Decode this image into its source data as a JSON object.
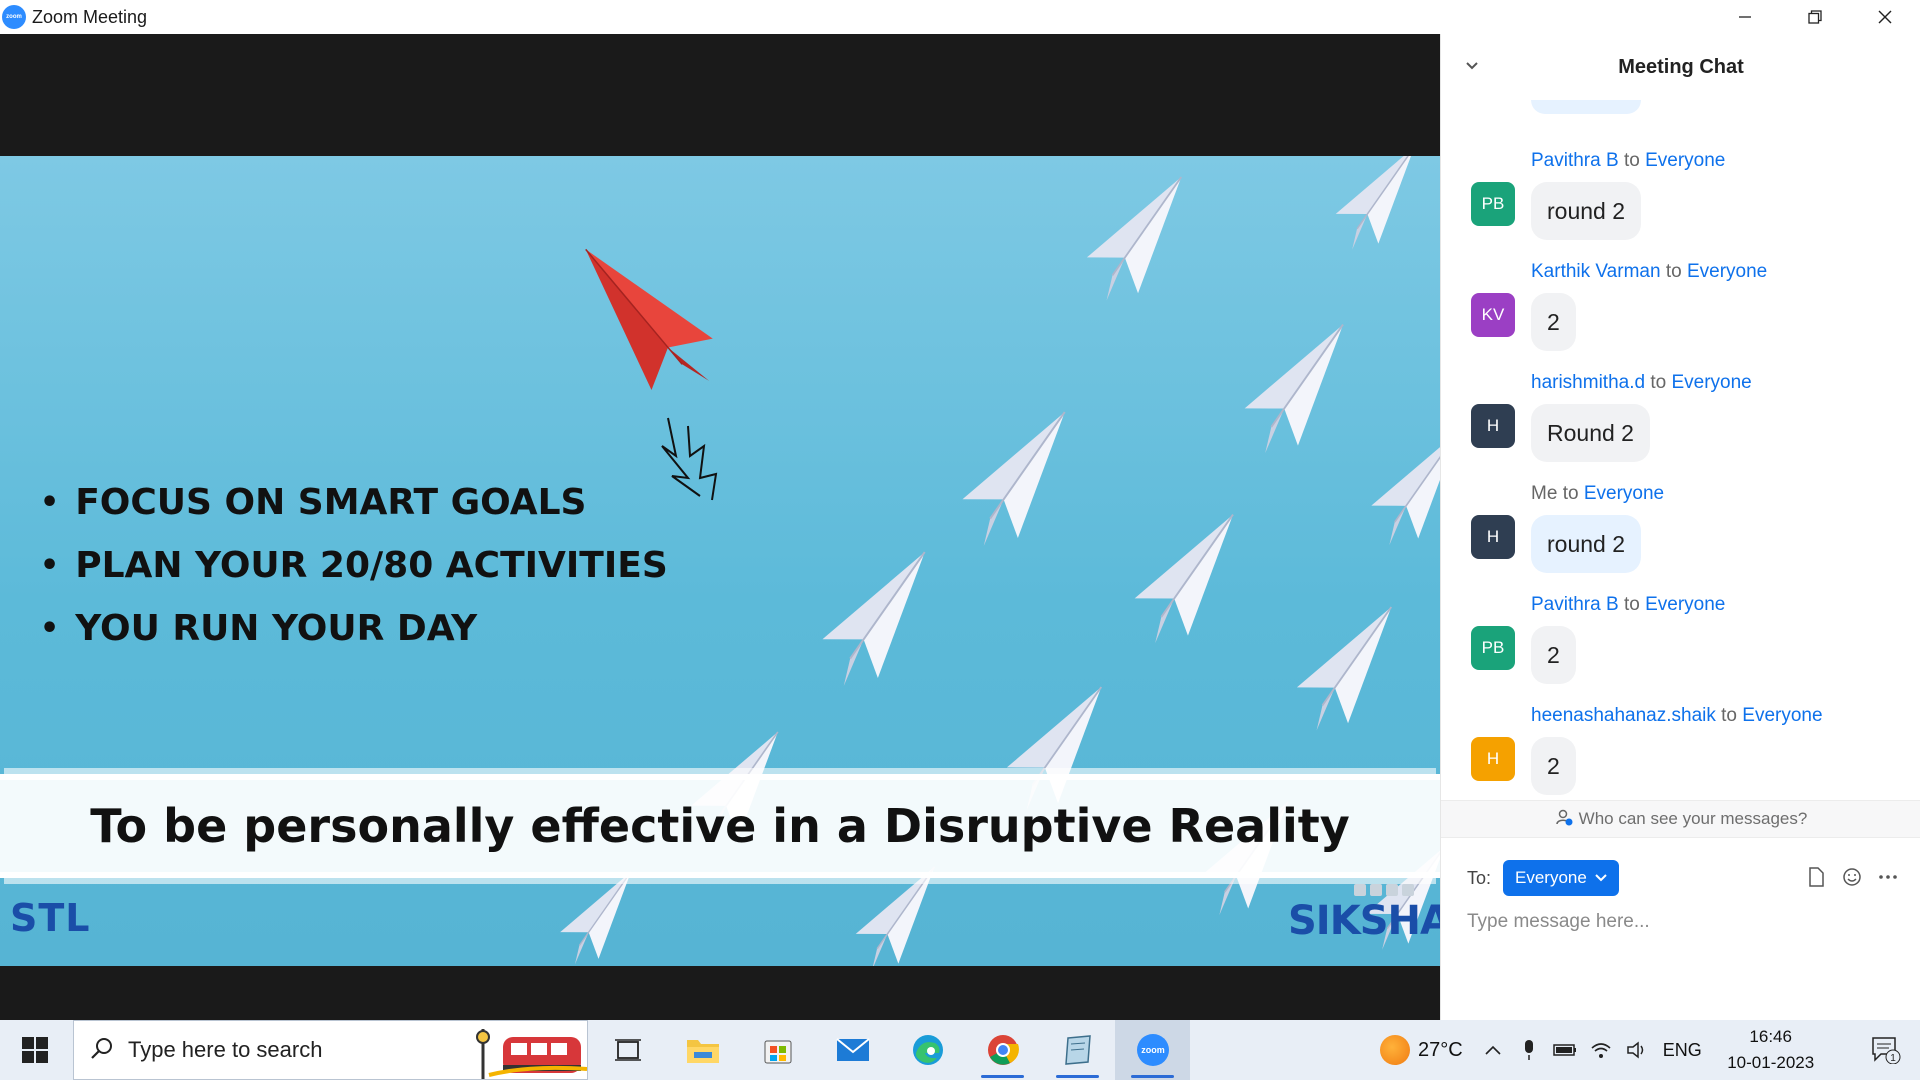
{
  "window": {
    "title": "Zoom Meeting",
    "logo_text": "zoom"
  },
  "slide": {
    "bullets": [
      "FOCUS ON SMART GOALS",
      "PLAN YOUR 20/80 ACTIVITIES",
      "YOU RUN YOUR DAY"
    ],
    "banner": "To be personally effective in a Disruptive Reality",
    "left_logo": "STL",
    "right_logo": "SIKSHA",
    "right_logo_tm": "™"
  },
  "chat": {
    "title": "Meeting Chat",
    "messages": [
      {
        "sender": "Pavithra B",
        "to_word": "to",
        "target": "Everyone",
        "initials": "PB",
        "avatar_color": "#1aa37a",
        "text": "round 2",
        "is_me": false
      },
      {
        "sender": "Karthik Varman",
        "to_word": "to",
        "target": "Everyone",
        "initials": "KV",
        "avatar_color": "#9b3fc4",
        "text": "2",
        "is_me": false
      },
      {
        "sender": "harishmitha.d",
        "to_word": "to",
        "target": "Everyone",
        "initials": "H",
        "avatar_color": "#2f3e52",
        "text": "Round 2",
        "is_me": false
      },
      {
        "sender": "Me",
        "to_word": "to",
        "target": "Everyone",
        "initials": "H",
        "avatar_color": "#2f3e52",
        "text": "round 2",
        "is_me": true
      },
      {
        "sender": "Pavithra B",
        "to_word": "to",
        "target": "Everyone",
        "initials": "PB",
        "avatar_color": "#1aa37a",
        "text": "2",
        "is_me": false
      },
      {
        "sender": "heenashahanaz.shaik",
        "to_word": "to",
        "target": "Everyone",
        "initials": "H",
        "avatar_color": "#f5a100",
        "text": "2",
        "is_me": false
      }
    ],
    "privacy_text": "Who can see your messages?",
    "to_label": "To:",
    "to_selected": "Everyone",
    "input_placeholder": "Type message here..."
  },
  "taskbar": {
    "search_placeholder": "Type here to search",
    "apps": [
      "task-view",
      "file-explorer",
      "microsoft-store",
      "mail",
      "edge",
      "chrome",
      "notes",
      "zoom"
    ],
    "zoom_label": "zoom",
    "temperature": "27°C",
    "language": "ENG",
    "time": "16:46",
    "date": "10-01-2023",
    "notification_count": "1"
  },
  "colors": {
    "accent": "#0e71eb",
    "zoom_blue": "#2d8cff",
    "slide_bg": "#5cbad9"
  }
}
